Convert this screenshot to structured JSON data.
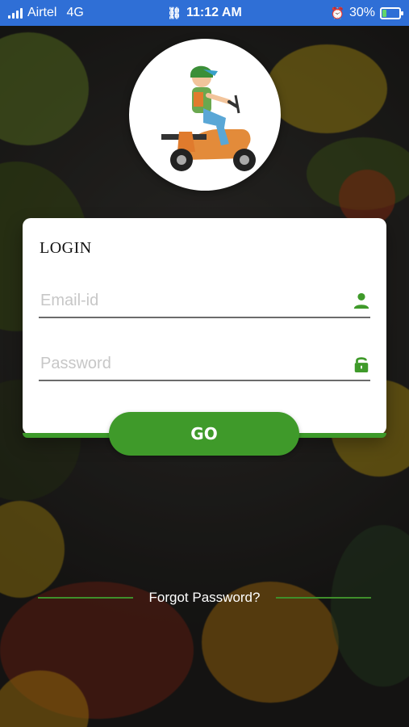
{
  "status_bar": {
    "carrier": "Airtel",
    "network": "4G",
    "time": "11:12 AM",
    "battery_percent": "30%",
    "battery_level": 0.3
  },
  "login_card": {
    "title": "LOGIN",
    "email_placeholder": "Email-id",
    "password_placeholder": "Password"
  },
  "actions": {
    "go_label": "GO",
    "forgot_password_label": "Forgot Password?"
  },
  "colors": {
    "status_bar_bg": "#2f6fd6",
    "accent_green": "#3f9a2a"
  },
  "icons": {
    "email": "user-icon",
    "password": "lock-open-icon"
  }
}
